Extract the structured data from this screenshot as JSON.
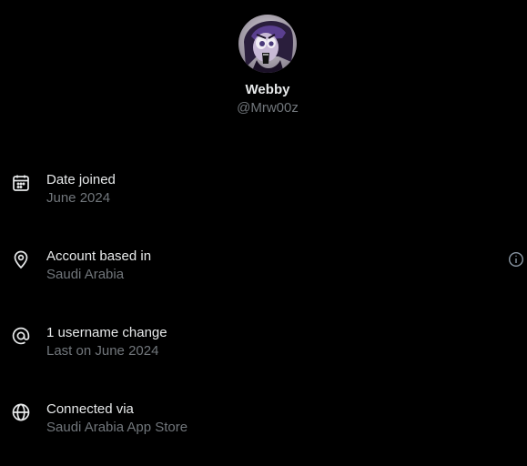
{
  "profile": {
    "display_name": "Webby",
    "handle": "@Mrw00z"
  },
  "rows": [
    {
      "icon": "calendar-icon",
      "title": "Date joined",
      "subtitle": "June 2024"
    },
    {
      "icon": "location-pin-icon",
      "title": "Account based in",
      "subtitle": "Saudi Arabia",
      "info_icon": "info-icon"
    },
    {
      "icon": "at-sign-icon",
      "title": "1 username change",
      "subtitle": "Last on June 2024"
    },
    {
      "icon": "globe-icon",
      "title": "Connected via",
      "subtitle": "Saudi Arabia App Store"
    }
  ],
  "colors": {
    "background": "#000000",
    "primary_text": "#e7e9ea",
    "secondary_text": "#71767b"
  }
}
